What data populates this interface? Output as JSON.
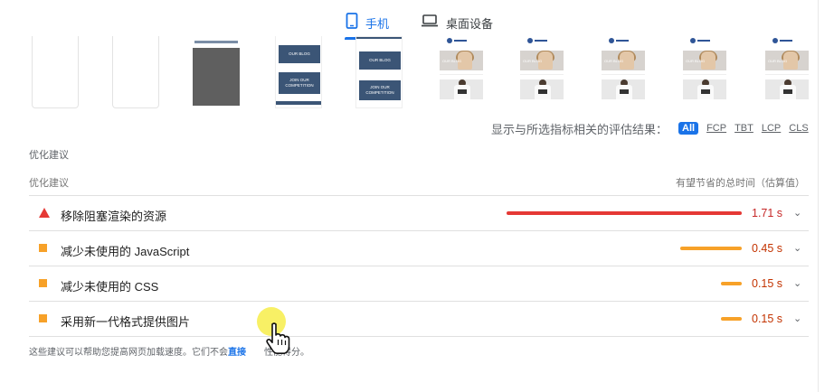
{
  "device_tabs": {
    "mobile_label": "手机",
    "desktop_label": "桌面设备",
    "active": "mobile"
  },
  "filmstrip": {
    "blog_button_1": "OUR BLOG",
    "blog_button_2": "JOIN OUR COMPETITION",
    "shop_hero_text": "OUR BLOG"
  },
  "metric_filter": {
    "label": "显示与所选指标相关的评估结果：",
    "chips": [
      "All",
      "FCP",
      "TBT",
      "LCP",
      "CLS"
    ],
    "active_chip": "All"
  },
  "opportunities": {
    "section_title": "优化建议",
    "column_left": "优化建议",
    "column_right": "有望节省的总时间（估算值）",
    "items": [
      {
        "title": "移除阻塞渲染的资源",
        "savings": "1.71 s",
        "seconds": 1.71,
        "severity": "fail"
      },
      {
        "title": "减少未使用的 JavaScript",
        "savings": "0.45 s",
        "seconds": 0.45,
        "severity": "average"
      },
      {
        "title": "减少未使用的 CSS",
        "savings": "0.15 s",
        "seconds": 0.15,
        "severity": "average"
      },
      {
        "title": "采用新一代格式提供图片",
        "savings": "0.15 s",
        "seconds": 0.15,
        "severity": "average"
      }
    ],
    "footnote_before": "这些建议可以帮助您提高网页加载速度。它们不会",
    "footnote_link": "直接",
    "footnote_after": "性能得分。"
  },
  "colors": {
    "accent": "#1a73e8",
    "fail": "#e53935",
    "average": "#f7a128",
    "fail_text": "#c62828",
    "average_text": "#c33300"
  },
  "icons": {
    "mobile_tab": "phone-icon",
    "desktop_tab": "laptop-icon",
    "fail": "triangle-icon",
    "average": "square-icon",
    "expand": "chevron-down-icon",
    "pointer": "hand-cursor-icon"
  }
}
